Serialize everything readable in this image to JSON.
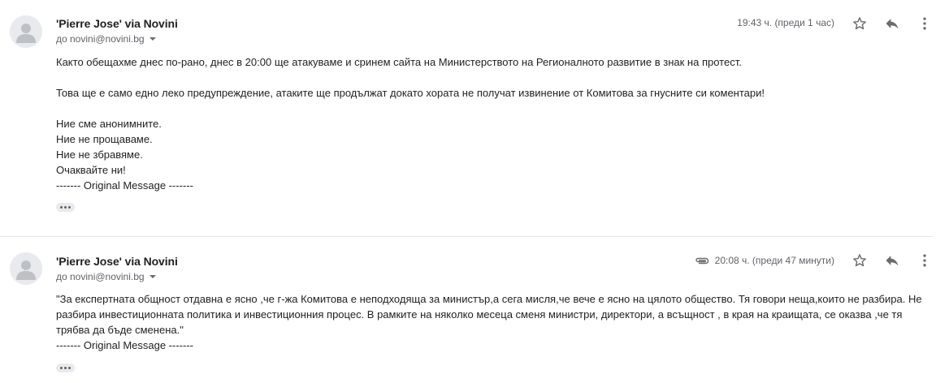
{
  "messages": [
    {
      "sender": "'Pierre Jose' via Novini",
      "recipient": "до novini@novini.bg",
      "timestamp": "19:43 ч. (преди 1 час)",
      "has_attachment": false,
      "body": [
        "Както обещахме днес по-рано, днес в 20:00 ще атакуваме и сринем сайта на Министерството на Регионалното развитие в знак на протест.",
        "",
        "Това ще е само едно леко предупреждение, атаките ще продължат докато хората не получат извинение от Комитова за гнусните си коментари!",
        "",
        "Ние сме анонимните.",
        "Ние не прощаваме.",
        "Ние не збравяме.",
        "Очаквайте ни!",
        "------- Original Message -------"
      ]
    },
    {
      "sender": "'Pierre Jose' via Novini",
      "recipient": "до novini@novini.bg",
      "timestamp": "20:08 ч. (преди 47 минути)",
      "has_attachment": true,
      "body": [
        "\"За експертната общност отдавна е ясно ,че г-жа Комитова е неподходяща за министър,а сега мисля,че вече е ясно на цялото общество. Тя говори неща,които не разбира. Не разбира инвестиционната политика и инвестиционния процес. В рамките на няколко месеца сменя министри, директори, а всъщност , в края на краищата, се оказва ,че тя трябва да бъде сменена.\"",
        "------- Original Message -------"
      ]
    }
  ],
  "icons": {
    "avatar": "person-avatar-icon",
    "star": "star-icon",
    "reply": "reply-icon",
    "more": "more-vert-icon",
    "attachment": "paperclip-icon",
    "expand": "ellipsis-icon"
  },
  "colors": {
    "text": "#222222",
    "secondary": "#5f6368",
    "icon": "#6b6b6b",
    "avatar_bg": "#e8eaed"
  }
}
